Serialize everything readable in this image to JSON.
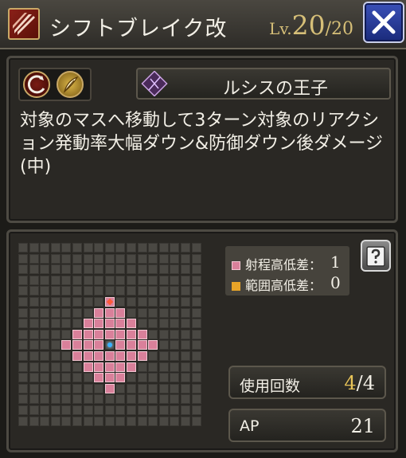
{
  "header": {
    "title": "シフトブレイク改",
    "level_label": "Lv.",
    "level_current": "20",
    "level_separator": "/",
    "level_max": "20",
    "skill_icon": "claw-slash-icon",
    "close_icon": "close-x-icon"
  },
  "info": {
    "icons": [
      "jump-icon",
      "feather-icon"
    ],
    "character_emblem": "crest-emblem-icon",
    "character_name": "ルシスの王子",
    "description": "対象のマスへ移動して3ターン対象のリアクション発動率大幅ダウン&防御ダウン後ダメージ(中)"
  },
  "range": {
    "legend": [
      {
        "label": "射程高低差：",
        "value": "1",
        "color": "#d9809a"
      },
      {
        "label": "範囲高低差：",
        "value": "0",
        "color": "#e8a428"
      }
    ],
    "help_icon": "help-book-icon",
    "grid_cols": 17,
    "grid_rows": 17
  },
  "stats": {
    "uses_label": "使用回数",
    "uses_current": "4",
    "uses_sep": "/",
    "uses_max": "4",
    "ap_label": "AP",
    "ap_value": "21"
  },
  "colors": {
    "accent_gold": "#d6bf78",
    "range_pink": "#d9809a",
    "close_blue": "#2a3ea0"
  }
}
